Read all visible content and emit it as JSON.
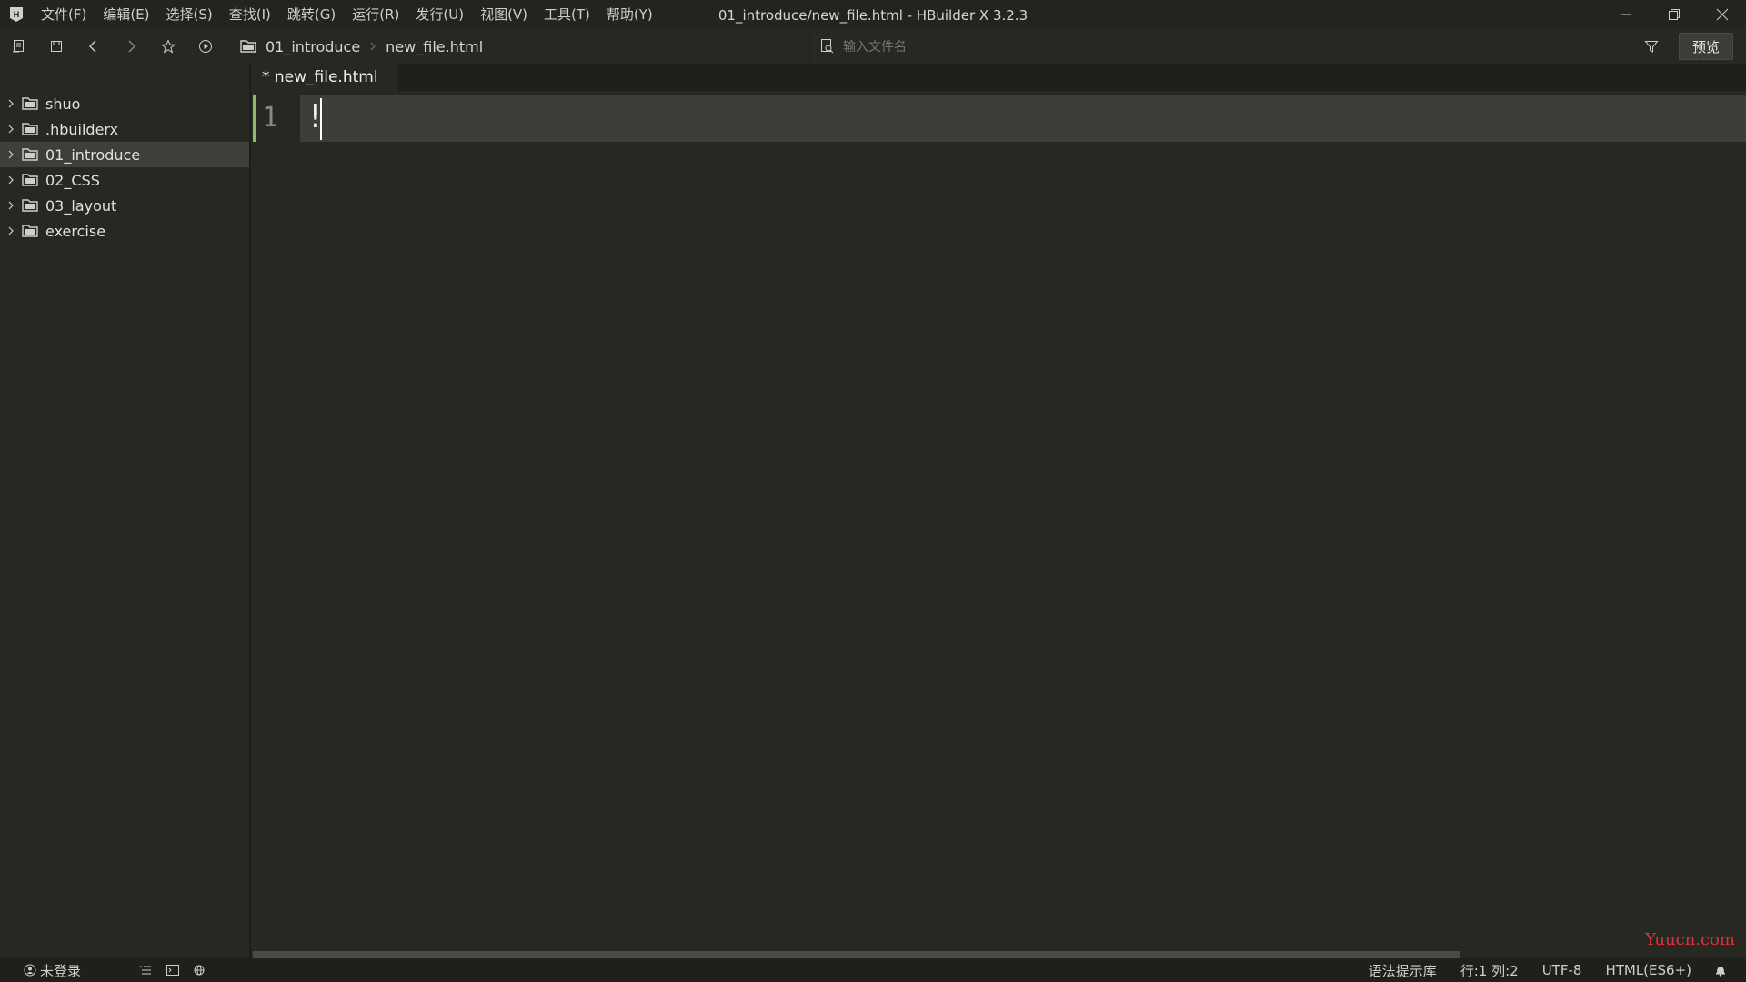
{
  "window": {
    "title": "01_introduce/new_file.html - HBuilder X 3.2.3"
  },
  "menu": [
    {
      "label": "文件(F)"
    },
    {
      "label": "编辑(E)"
    },
    {
      "label": "选择(S)"
    },
    {
      "label": "查找(I)"
    },
    {
      "label": "跳转(G)"
    },
    {
      "label": "运行(R)"
    },
    {
      "label": "发行(U)"
    },
    {
      "label": "视图(V)"
    },
    {
      "label": "工具(T)"
    },
    {
      "label": "帮助(Y)"
    }
  ],
  "toolbar": {
    "breadcrumb": [
      "01_introduce",
      "new_file.html"
    ],
    "search_placeholder": "输入文件名",
    "preview_label": "预览",
    "icons": [
      "new-file-icon",
      "save-icon",
      "back-icon",
      "forward-icon",
      "star-icon",
      "run-icon",
      "folder-icon",
      "file-search-icon",
      "filter-icon"
    ]
  },
  "sidebar": {
    "items": [
      {
        "label": "shuo",
        "selected": false
      },
      {
        "label": ".hbuilderx",
        "selected": false
      },
      {
        "label": "01_introduce",
        "selected": true
      },
      {
        "label": "02_CSS",
        "selected": false
      },
      {
        "label": "03_layout",
        "selected": false
      },
      {
        "label": "exercise",
        "selected": false
      }
    ]
  },
  "editor": {
    "tab_label": "* new_file.html",
    "line_number": "1",
    "code_text": "!",
    "watermark": "Yuucn.com"
  },
  "statusbar": {
    "login": "未登录",
    "syntax_lib": "语法提示库",
    "position": "行:1  列:2",
    "encoding": "UTF-8",
    "language": "HTML(ES6+)"
  },
  "colors": {
    "background": "#272822",
    "titlebar": "#23241f",
    "selected_item": "#3e3f39",
    "gutter_mark": "#8fb868",
    "watermark": "#e0303a"
  }
}
